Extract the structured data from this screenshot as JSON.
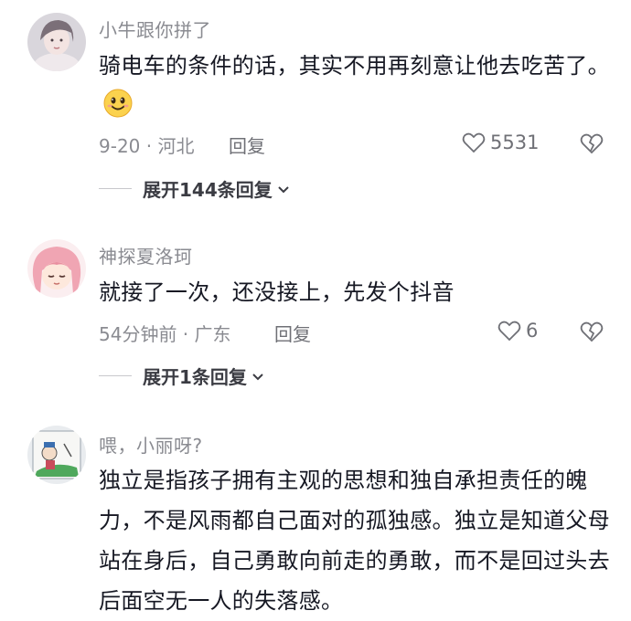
{
  "comments": [
    {
      "username": "小牛跟你拼了",
      "text": "骑电车的条件的话，其实不用再刻意让他去吃苦了。",
      "emoji": "smile-emoji",
      "meta": "9-20 · 河北",
      "reply": "回复",
      "likes": "5531",
      "expand": "展开144条回复"
    },
    {
      "username": "神探夏洛珂",
      "text": "就接了一次，还没接上，先发个抖音",
      "meta": "54分钟前 · 广东",
      "reply": "回复",
      "likes": "6",
      "expand": "展开1条回复"
    },
    {
      "username": "喂，小丽呀?",
      "text": "独立是指孩子拥有主观的思想和独自承担责任的魄力，不是风雨都自己面对的孤独感。独立是知道父母站在身后，自己勇敢向前走的勇敢，而不是回过头去后面空无一人的失落感。"
    }
  ],
  "colors": {
    "text": "#161823",
    "muted": "#8a8b91",
    "background": "#ffffff"
  },
  "icons": {
    "like": "heart-icon",
    "dislike": "broken-heart-icon",
    "expand": "chevron-down-icon"
  }
}
